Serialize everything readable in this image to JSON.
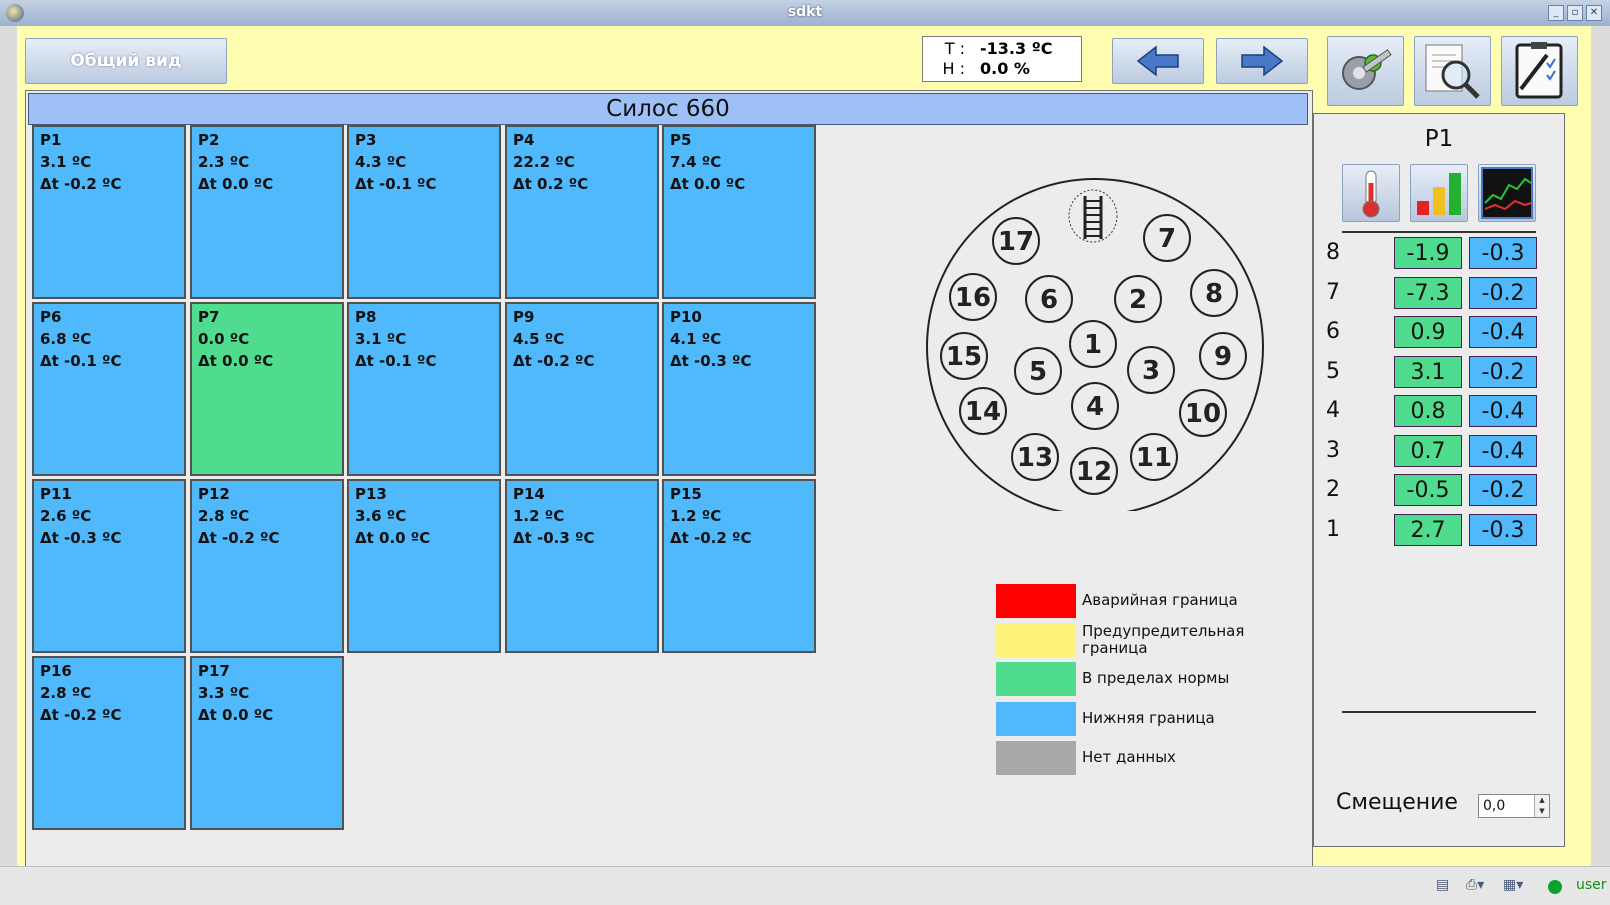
{
  "window": {
    "title": "sdkt"
  },
  "toolbar": {
    "overview_label": "Общий вид",
    "readout": {
      "t_label": "T :",
      "t_value": "-13.3 ºC",
      "h_label": "H :",
      "h_value": "0.0 %"
    },
    "icons": [
      "arrow-left-icon",
      "arrow-right-icon",
      "settings-wrench-icon",
      "report-search-icon",
      "checklist-pen-icon"
    ]
  },
  "silo": {
    "title": "Силос 660",
    "cells": [
      {
        "id": "P1",
        "temp": "3.1 ºC",
        "delta": "Δt -0.2 ºC",
        "state": "low"
      },
      {
        "id": "P2",
        "temp": "2.3 ºC",
        "delta": "Δt 0.0 ºC",
        "state": "low"
      },
      {
        "id": "P3",
        "temp": "4.3 ºC",
        "delta": "Δt -0.1 ºC",
        "state": "low"
      },
      {
        "id": "P4",
        "temp": "22.2 ºC",
        "delta": "Δt 0.2 ºC",
        "state": "low"
      },
      {
        "id": "P5",
        "temp": "7.4 ºC",
        "delta": "Δt 0.0 ºC",
        "state": "low"
      },
      {
        "id": "P6",
        "temp": "6.8 ºC",
        "delta": "Δt -0.1 ºC",
        "state": "low"
      },
      {
        "id": "P7",
        "temp": "0.0 ºC",
        "delta": "Δt 0.0 ºC",
        "state": "normal"
      },
      {
        "id": "P8",
        "temp": "3.1 ºC",
        "delta": "Δt -0.1 ºC",
        "state": "low"
      },
      {
        "id": "P9",
        "temp": "4.5 ºC",
        "delta": "Δt -0.2 ºC",
        "state": "low"
      },
      {
        "id": "P10",
        "temp": "4.1 ºC",
        "delta": "Δt -0.3 ºC",
        "state": "low"
      },
      {
        "id": "P11",
        "temp": "2.6 ºC",
        "delta": "Δt -0.3 ºC",
        "state": "low"
      },
      {
        "id": "P12",
        "temp": "2.8 ºC",
        "delta": "Δt -0.2 ºC",
        "state": "low"
      },
      {
        "id": "P13",
        "temp": "3.6 ºC",
        "delta": "Δt 0.0 ºC",
        "state": "low"
      },
      {
        "id": "P14",
        "temp": "1.2 ºC",
        "delta": "Δt -0.3 ºC",
        "state": "low"
      },
      {
        "id": "P15",
        "temp": "1.2 ºC",
        "delta": "Δt -0.2 ºC",
        "state": "low"
      },
      {
        "id": "P16",
        "temp": "2.8 ºC",
        "delta": "Δt -0.2 ºC",
        "state": "low"
      },
      {
        "id": "P17",
        "temp": "3.3 ºC",
        "delta": "Δt 0.0 ºC",
        "state": "low"
      }
    ],
    "diagram_numbers": [
      "1",
      "2",
      "3",
      "4",
      "5",
      "6",
      "7",
      "8",
      "9",
      "10",
      "11",
      "12",
      "13",
      "14",
      "15",
      "16",
      "17"
    ]
  },
  "legend": [
    {
      "color": "#ff0000",
      "label": "Аварийная граница",
      "label2": ""
    },
    {
      "color": "#fff27a",
      "label": "Предупредительная",
      "label2": "граница"
    },
    {
      "color": "#4fdc8e",
      "label": "В пределах нормы",
      "label2": ""
    },
    {
      "color": "#4fb9fb",
      "label": "Нижняя граница",
      "label2": ""
    },
    {
      "color": "#a9a9a9",
      "label": "Нет данных",
      "label2": ""
    }
  ],
  "colors": {
    "low": "#4fb9fb",
    "normal": "#4fdc8e",
    "panel_header": "#9ec0f6",
    "toolbar_bg": "#fffdb0"
  },
  "sidepanel": {
    "title": "P1",
    "icons": [
      "thermometer-icon",
      "bar-chart-icon",
      "line-chart-icon"
    ],
    "rows": [
      {
        "level": "8",
        "value": "-1.9",
        "delta": "-0.3"
      },
      {
        "level": "7",
        "value": "-7.3",
        "delta": "-0.2"
      },
      {
        "level": "6",
        "value": "0.9",
        "delta": "-0.4"
      },
      {
        "level": "5",
        "value": "3.1",
        "delta": "-0.2"
      },
      {
        "level": "4",
        "value": "0.8",
        "delta": "-0.4"
      },
      {
        "level": "3",
        "value": "0.7",
        "delta": "-0.4"
      },
      {
        "level": "2",
        "value": "-0.5",
        "delta": "-0.2"
      },
      {
        "level": "1",
        "value": "2.7",
        "delta": "-0.3"
      }
    ],
    "offset_label": "Смещение",
    "offset_value": "0,0"
  },
  "statusbar": {
    "user": "user"
  }
}
